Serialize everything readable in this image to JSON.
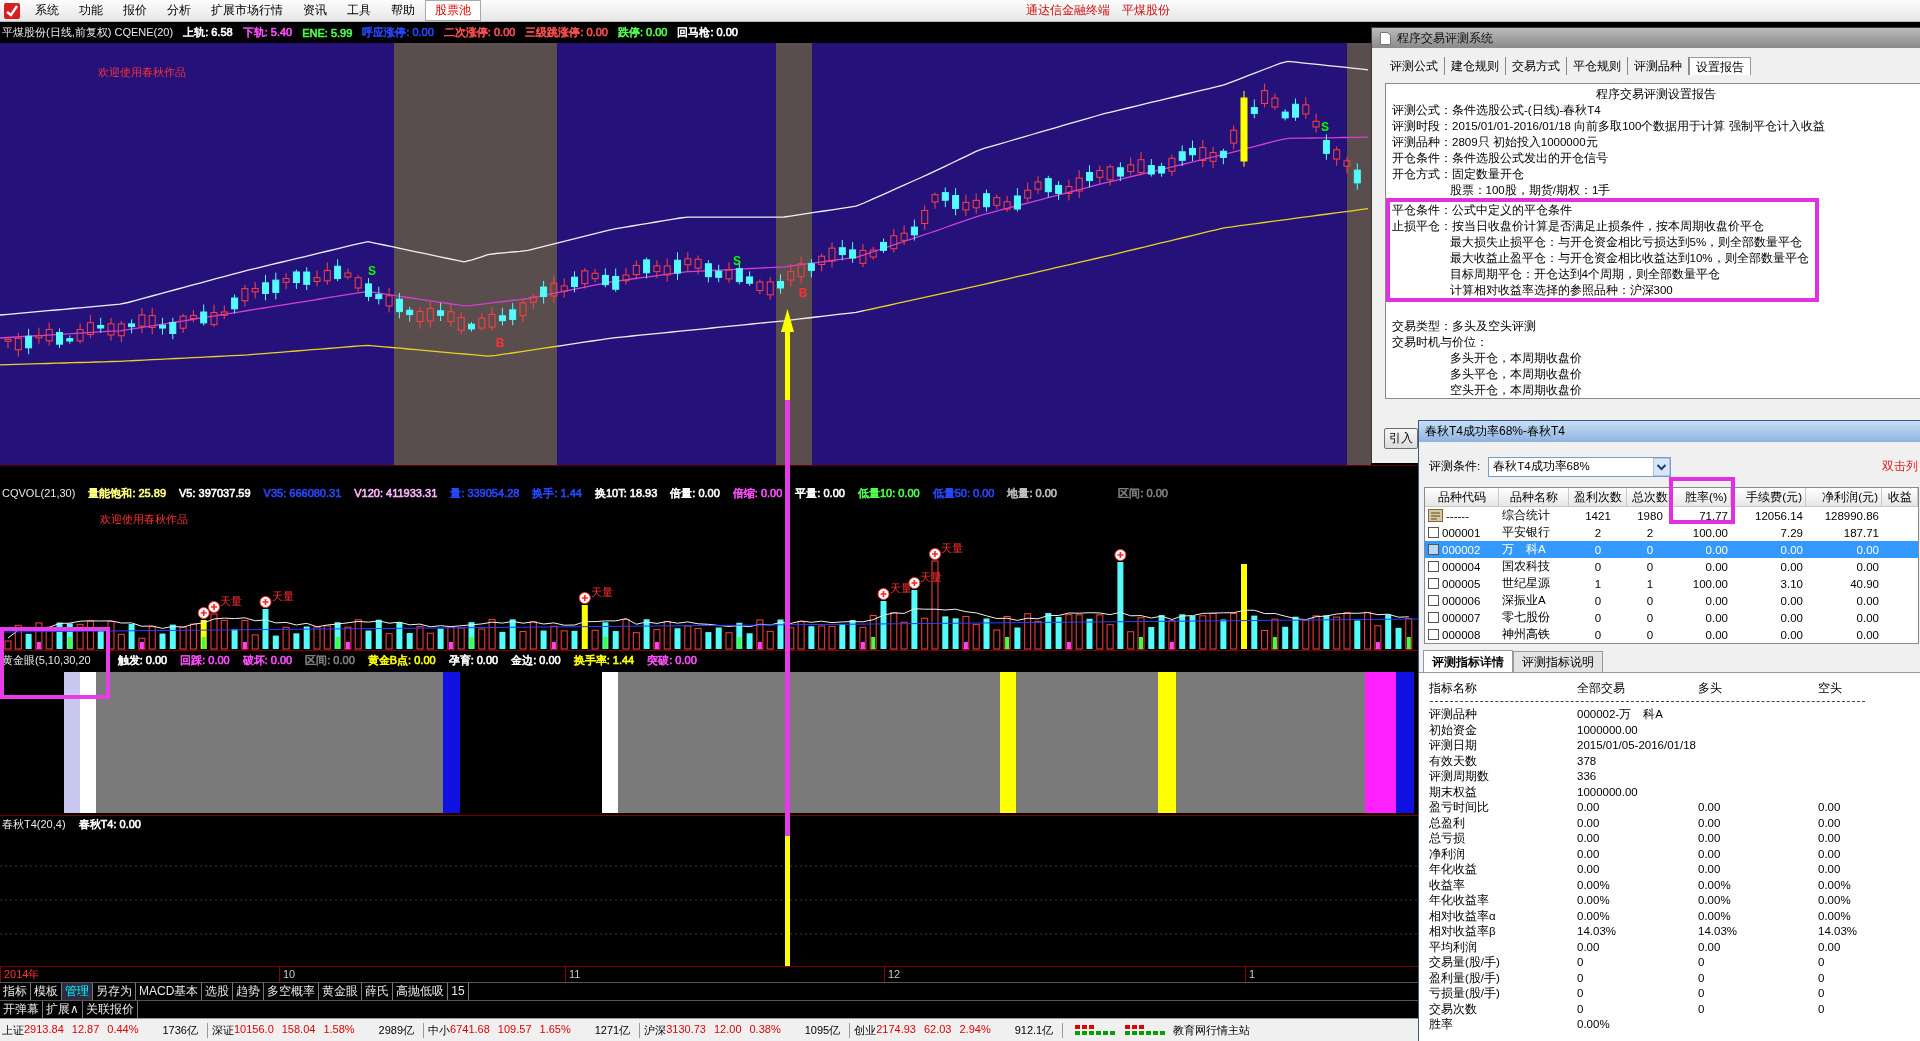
{
  "menu_bar": {
    "items": [
      {
        "label": "系统",
        "highlighted": false
      },
      {
        "label": "功能",
        "highlighted": false
      },
      {
        "label": "报价",
        "highlighted": false
      },
      {
        "label": "分析",
        "highlighted": false
      },
      {
        "label": "扩展市场行情",
        "highlighted": false
      },
      {
        "label": "资讯",
        "highlighted": false
      },
      {
        "label": "工具",
        "highlighted": false
      },
      {
        "label": "帮助",
        "highlighted": false
      },
      {
        "label": "股票池",
        "highlighted": true
      }
    ],
    "app_title": "通达信金融终端",
    "stock_title": "平煤股份"
  },
  "price_panel": {
    "title": "平煤股份(日线,前复权) CQENE(20)",
    "readings": [
      {
        "text": "上轨: 6.58",
        "color": "#ffffff"
      },
      {
        "text": "下轨: 5.40",
        "color": "#ff50ff"
      },
      {
        "text": "ENE: 5.99",
        "color": "#50ff50"
      },
      {
        "text": "呼应涨停: 0.00",
        "color": "#2848ff"
      },
      {
        "text": "二次涨停: 0.00",
        "color": "#ff5050"
      },
      {
        "text": "三级跳涨停: 0.00",
        "color": "#ff5050"
      },
      {
        "text": "跌停: 0.00",
        "color": "#50ff50"
      },
      {
        "text": "回马枪: 0.00",
        "color": "#ffffff"
      }
    ],
    "banner": "欢迎使用春秋作品",
    "signal_labels": [
      "S",
      "S",
      "S"
    ],
    "buy_labels": [
      "B",
      "B"
    ]
  },
  "volume_panel": {
    "title": "CQVOL(21,30)",
    "readings": [
      {
        "text": "量能饱和: 25.89",
        "color": "#ffff80"
      },
      {
        "text": "V5: 397037.59",
        "color": "#ffffff"
      },
      {
        "text": "V35: 666080.31",
        "color": "#2848ff"
      },
      {
        "text": "V120: 411933.31",
        "color": "#ffb4ff"
      },
      {
        "text": "量: 339054.28",
        "color": "#2848ff"
      },
      {
        "text": "换手: 1.44",
        "color": "#2848ff"
      },
      {
        "text": "换10T: 18.93",
        "color": "#ffffff"
      },
      {
        "text": "倍量: 0.00",
        "color": "#ffffff"
      },
      {
        "text": "倍缩: 0.00",
        "color": "#ff50ff"
      },
      {
        "text": "平量: 0.00",
        "color": "#ffffff"
      },
      {
        "text": "低量10: 0.00",
        "color": "#50ff50"
      },
      {
        "text": "低量50: 0.00",
        "color": "#2848ff"
      },
      {
        "text": "地量: 0.00",
        "color": "#c0c0c0"
      }
    ],
    "range_reading": {
      "text": "区间: 0.00",
      "color": "#808080"
    },
    "banner": "欢迎使用春秋作品",
    "spike_labels": [
      "天量",
      "天量",
      "天量",
      "天量",
      "天量",
      "天量"
    ]
  },
  "gold_eye_panel": {
    "title": "黄金眼(5,10,30,20",
    "readings": [
      {
        "text": "触发: 0.00",
        "color": "#ffffff"
      },
      {
        "text": "回踩: 0.00",
        "color": "#ff50ff"
      },
      {
        "text": "破坏: 0.00",
        "color": "#ff50ff"
      },
      {
        "text": "区间: 0.00",
        "color": "#808080"
      },
      {
        "text": "黄金B点: 0.00",
        "color": "#ffff00"
      },
      {
        "text": "孕育: 0.00",
        "color": "#ffffff"
      },
      {
        "text": "金边: 0.00",
        "color": "#ffffff"
      },
      {
        "text": "换手率: 1.44",
        "color": "#ffff00"
      },
      {
        "text": "突破: 0.00",
        "color": "#ff50ff"
      }
    ]
  },
  "t4_panel": {
    "title": "春秋T4(20,4)",
    "readings": [
      {
        "text": "春秋T4: 0.00",
        "color": "#ffffff"
      }
    ]
  },
  "time_axis": [
    {
      "text": "2014年",
      "kind": "year"
    },
    {
      "text": "10",
      "kind": "month"
    },
    {
      "text": "11",
      "kind": "month"
    },
    {
      "text": "12",
      "kind": "month"
    },
    {
      "text": "1",
      "kind": "month"
    }
  ],
  "bottom_tabs": [
    {
      "label": "指标",
      "selected": false
    },
    {
      "label": "模板",
      "selected": false
    },
    {
      "label": "管理",
      "selected": true
    },
    {
      "label": "另存为",
      "selected": false
    },
    {
      "label": "MACD基本",
      "selected": false
    },
    {
      "label": "选股",
      "selected": false
    },
    {
      "label": "趋势",
      "selected": false
    },
    {
      "label": "多空概率",
      "selected": false
    },
    {
      "label": "黄金眼",
      "selected": false
    },
    {
      "label": "薛氏",
      "selected": false
    },
    {
      "label": "高抛低吸",
      "selected": false
    },
    {
      "label": "15",
      "selected": false
    }
  ],
  "bottom_buttons": [
    "开弹幕",
    "扩展∧",
    "关联报价"
  ],
  "status_bar": {
    "indices": [
      {
        "name": "上证",
        "value": "2913.84",
        "change": "12.87",
        "percent": "0.44%",
        "turnover": "1736亿"
      },
      {
        "name": "深证",
        "value": "10156.0",
        "change": "158.04",
        "percent": "1.58%",
        "turnover": "2989亿"
      },
      {
        "name": "中小",
        "value": "6741.68",
        "change": "109.57",
        "percent": "1.65%",
        "turnover": "1271亿"
      },
      {
        "name": "沪深",
        "value": "3130.73",
        "change": "12.00",
        "percent": "0.38%",
        "turnover": "1095亿"
      },
      {
        "name": "创业",
        "value": "2174.93",
        "change": "62.03",
        "percent": "2.94%",
        "turnover": "912.1亿"
      }
    ],
    "server": "教育网行情主站"
  },
  "evaluation_window": {
    "title": "程序交易评测系统",
    "tabs": [
      {
        "label": "评测公式",
        "selected": false
      },
      {
        "label": "建仓规则",
        "selected": false
      },
      {
        "label": "交易方式",
        "selected": false
      },
      {
        "label": "平仓规则",
        "selected": false
      },
      {
        "label": "评测品种",
        "selected": false
      },
      {
        "label": "设置报告",
        "selected": true
      }
    ],
    "report": {
      "title": "程序交易评测设置报告",
      "entries": [
        {
          "label": "评测公式：",
          "text": "条件选股公式-(日线)-春秋T4",
          "highlighted": false
        },
        {
          "label": "评测时段：",
          "text": "2015/01/01-2016/01/18 向前多取100个数据用于计算 强制平仓计入收益",
          "highlighted": false
        },
        {
          "label": "评测品种：",
          "text": "2809只 初始投入1000000元",
          "highlighted": false
        },
        {
          "label": "开仓条件：",
          "text": "条件选股公式发出的开仓信号",
          "highlighted": false
        },
        {
          "label": "开仓方式：",
          "text": "固定数量开仓",
          "highlighted": false,
          "children": [
            {
              "text": "股票：100股，期货/期权：1手"
            }
          ]
        },
        {
          "label": "平仓条件：",
          "text": "公式中定义的平仓条件",
          "highlighted": true
        },
        {
          "label": "止损平仓：",
          "text": "按当日收盘价计算是否满足止损条件，按本周期收盘价平仓",
          "highlighted": true,
          "children": [
            {
              "text": "最大损失止损平仓：与开仓资金相比亏损达到5%，则全部数量平仓"
            },
            {
              "text": "最大收益止盈平仓：与开仓资金相比收益达到10%，则全部数量平仓"
            },
            {
              "text": "目标周期平仓：开仓达到4个周期，则全部数量平仓"
            },
            {
              "text": "计算相对收益率选择的参照品种：沪深300"
            }
          ]
        },
        {
          "label": "交易类型：",
          "text": "多头及空头评测",
          "highlighted": false
        },
        {
          "label": "交易时机与价位：",
          "highlighted": false,
          "children": [
            {
              "text": "多头开仓，本周期收盘价"
            },
            {
              "text": "多头平仓，本周期收盘价"
            },
            {
              "text": "空头开仓，本周期收盘价"
            }
          ]
        }
      ]
    },
    "import_button": "引入"
  },
  "result_window": {
    "title": "春秋T4成功率68%-春秋T4",
    "condition": {
      "label": "评测条件:",
      "value": "春秋T4成功率68%"
    },
    "hint": "双击列",
    "table": {
      "columns": [
        "品种代码",
        "品种名称",
        "盈利次数",
        "总次数",
        "胜率(%)",
        "手续费(元)",
        "净利润(元)",
        "收益"
      ],
      "summary": {
        "cells": [
          "------",
          "综合统计",
          "1421",
          "1980",
          "71.77",
          "12056.14",
          "128990.86"
        ]
      },
      "rows": [
        {
          "cells": [
            "000001",
            "平安银行",
            "2",
            "2",
            "100.00",
            "7.29",
            "187.71"
          ],
          "checked": false,
          "selected": false
        },
        {
          "cells": [
            "000002",
            "万　科A",
            "0",
            "0",
            "0.00",
            "0.00",
            "0.00"
          ],
          "checked": false,
          "selected": true
        },
        {
          "cells": [
            "000004",
            "国农科技",
            "0",
            "0",
            "0.00",
            "0.00",
            "0.00"
          ],
          "checked": false,
          "selected": false
        },
        {
          "cells": [
            "000005",
            "世纪星源",
            "1",
            "1",
            "100.00",
            "3.10",
            "40.90"
          ],
          "checked": false,
          "selected": false
        },
        {
          "cells": [
            "000006",
            "深振业A",
            "0",
            "0",
            "0.00",
            "0.00",
            "0.00"
          ],
          "checked": false,
          "selected": false
        },
        {
          "cells": [
            "000007",
            "零七股份",
            "0",
            "0",
            "0.00",
            "0.00",
            "0.00"
          ],
          "checked": false,
          "selected": false
        },
        {
          "cells": [
            "000008",
            "神州高铁",
            "0",
            "0",
            "0.00",
            "0.00",
            "0.00"
          ],
          "checked": false,
          "selected": false
        }
      ]
    },
    "detail_tabs": [
      {
        "label": "评测指标详情",
        "selected": true
      },
      {
        "label": "评测指标说明",
        "selected": false
      }
    ],
    "details": {
      "columns": [
        "指标名称",
        "全部交易",
        "多头",
        "空头"
      ],
      "rows": [
        {
          "name": "评测品种",
          "values": [
            "000002-万　科A"
          ]
        },
        {
          "name": "初始资金",
          "values": [
            "1000000.00"
          ]
        },
        {
          "name": "评测日期",
          "values": [
            "2015/01/05-2016/01/18"
          ]
        },
        {
          "name": "有效天数",
          "values": [
            "378"
          ]
        },
        {
          "name": "评测周期数",
          "values": [
            "336"
          ]
        },
        {
          "name": "期末权益",
          "values": [
            "1000000.00"
          ]
        },
        {
          "name": "盈亏时间比",
          "values": [
            "0.00",
            "0.00",
            "0.00"
          ]
        },
        {
          "name": "总盈利",
          "values": [
            "0.00",
            "0.00",
            "0.00"
          ]
        },
        {
          "name": "总亏损",
          "values": [
            "0.00",
            "0.00",
            "0.00"
          ]
        },
        {
          "name": "净利润",
          "values": [
            "0.00",
            "0.00",
            "0.00"
          ]
        },
        {
          "name": "年化收益",
          "values": [
            "0.00",
            "0.00",
            "0.00"
          ]
        },
        {
          "name": "收益率",
          "values": [
            "0.00%",
            "0.00%",
            "0.00%"
          ]
        },
        {
          "name": "年化收益率",
          "values": [
            "0.00%",
            "0.00%",
            "0.00%"
          ]
        },
        {
          "name": "相对收益率α",
          "values": [
            "0.00%",
            "0.00%",
            "0.00%"
          ]
        },
        {
          "name": "相对收益率β",
          "values": [
            "14.03%",
            "14.03%",
            "14.03%"
          ]
        },
        {
          "name": "平均利润",
          "values": [
            "0.00",
            "0.00",
            "0.00"
          ]
        },
        {
          "name": "交易量(股/手)",
          "values": [
            "0",
            "0",
            "0"
          ]
        },
        {
          "name": "盈利量(股/手)",
          "values": [
            "0",
            "0",
            "0"
          ]
        },
        {
          "name": "亏损量(股/手)",
          "values": [
            "0",
            "0",
            "0"
          ]
        },
        {
          "name": "交易次数",
          "values": [
            "0",
            "0",
            "0"
          ]
        },
        {
          "name": "胜率",
          "values": [
            "0.00%"
          ]
        }
      ]
    }
  }
}
